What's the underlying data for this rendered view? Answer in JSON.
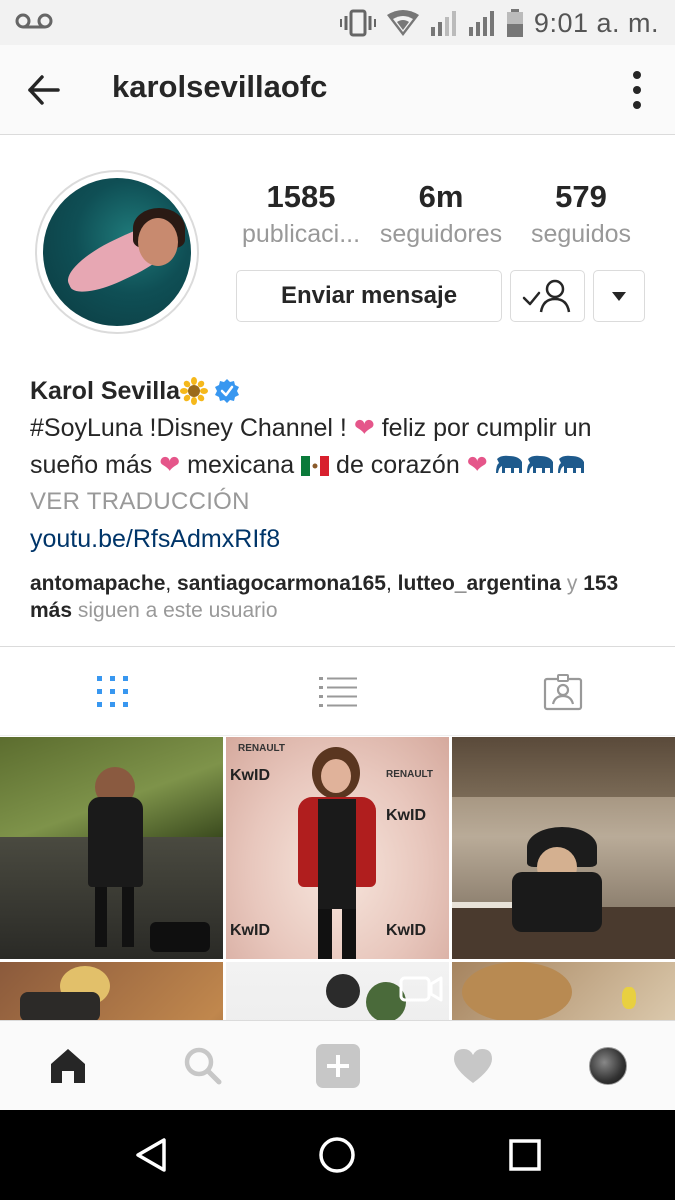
{
  "status_bar": {
    "time": "9:01 a. m.",
    "icons": [
      "voicemail-icon",
      "vibrate-icon",
      "wifi-icon",
      "signal-icon",
      "signal-icon",
      "battery-icon"
    ]
  },
  "header": {
    "username": "karolsevillaofc",
    "back_icon": "arrow-left-icon",
    "menu_icon": "more-vertical-icon"
  },
  "profile": {
    "stats": [
      {
        "value": "1585",
        "label": "publicaci..."
      },
      {
        "value": "6m",
        "label": "seguidores"
      },
      {
        "value": "579",
        "label": "seguidos"
      }
    ],
    "message_button": "Enviar mensaje",
    "follow_icon": "person-check-icon",
    "dropdown_icon": "caret-down-icon"
  },
  "bio": {
    "name": "Karol Sevilla",
    "line1": "#SoyLuna !Disney Channel ! ",
    "line1_after": " feliz por cumplir un",
    "line2_a": "sueño más ",
    "line2_b": " mexicana ",
    "line2_c": " de corazón ",
    "translate": "VER TRADUCCIÓN",
    "link": "youtu.be/RfsAdmxRIf8",
    "followers": {
      "names": [
        "antomapache",
        "santiagocarmona165",
        "lutteo_argentina"
      ],
      "sep1": ", ",
      "sep2": ", ",
      "and": " y ",
      "more": "153 más",
      "suffix": " siguen a este usuario"
    },
    "colors": {
      "heart": "#e5568a",
      "verified": "#3897f0",
      "link": "#003569"
    }
  },
  "tabs": [
    {
      "icon": "grid-icon",
      "active": true
    },
    {
      "icon": "list-icon",
      "active": false
    },
    {
      "icon": "tagged-icon",
      "active": false
    }
  ],
  "photos": {
    "p1": {
      "alt": "concert-photo"
    },
    "p2": {
      "alt": "renault-kwid-event-photo",
      "kwid_text": "KwID",
      "renault_text": "RENAULT"
    },
    "p3": {
      "alt": "terrace-photo"
    },
    "p4": {
      "alt": "wood-wall-photo"
    },
    "p5": {
      "alt": "video-photo"
    },
    "p6": {
      "alt": "hair-photo"
    }
  },
  "bottom_nav": [
    "home-icon",
    "search-icon",
    "add-icon",
    "heart-icon",
    "profile-avatar"
  ],
  "android_nav": [
    "back-triangle-icon",
    "home-circle-icon",
    "recent-square-icon"
  ]
}
